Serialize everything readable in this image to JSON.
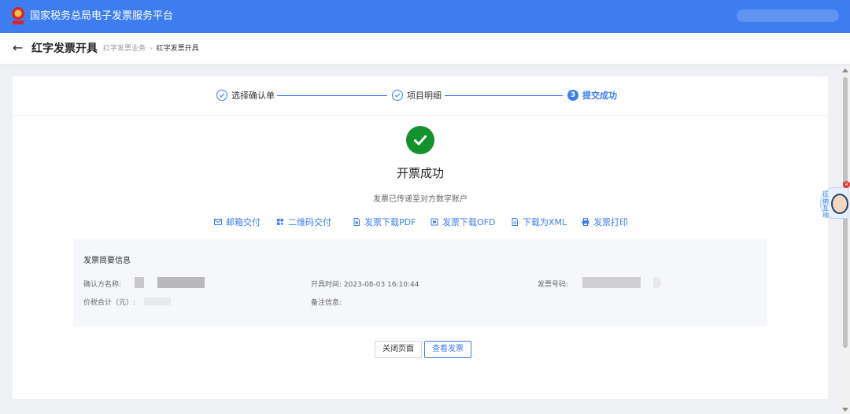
{
  "header": {
    "app_title": "国家税务总局电子发票服务平台"
  },
  "subheader": {
    "page_title": "红字发票开具",
    "breadcrumb": [
      "红字发票业务",
      "红字发票开具"
    ]
  },
  "steps": [
    {
      "label": "选择确认单",
      "state": "done"
    },
    {
      "label": "项目明细",
      "state": "done"
    },
    {
      "label": "提交成功",
      "state": "active",
      "number": "3"
    }
  ],
  "result": {
    "title": "开票成功",
    "subtitle": "发票已传递至对方数字账户"
  },
  "actions": [
    {
      "label": "邮箱交付",
      "icon": "mail-icon"
    },
    {
      "label": "二维码交付",
      "icon": "qrcode-icon"
    },
    {
      "label": "发票下载PDF",
      "icon": "pdf-file-icon"
    },
    {
      "label": "发票下载OFD",
      "icon": "ofd-file-icon"
    },
    {
      "label": "下载为XML",
      "icon": "xml-file-icon"
    },
    {
      "label": "发票打印",
      "icon": "printer-icon"
    }
  ],
  "summary": {
    "title": "发票简要信息",
    "buyer_label": "确认方名称:",
    "issue_time_label": "开具时间:",
    "issue_time_value": "2023-08-03 16:10:44",
    "invoice_no_label": "发票号码:",
    "total_label": "价税合计（元）:",
    "remark_label": "备注信息:"
  },
  "buttons": {
    "close": "关闭页面",
    "view": "查看发票"
  },
  "assistant": {
    "badge": "4",
    "text": "征纳互动"
  },
  "colors": {
    "primary": "#3e7df0",
    "success": "#14912f"
  }
}
